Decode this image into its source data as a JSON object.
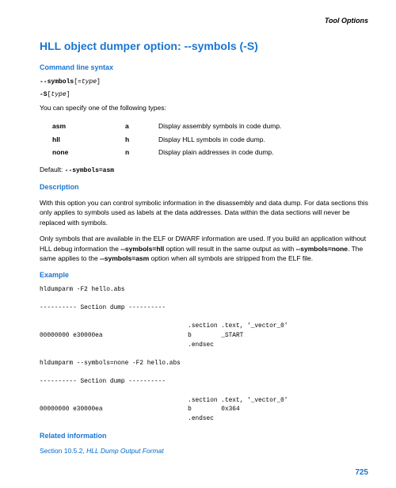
{
  "header": {
    "section": "Tool Options"
  },
  "title": "HLL object dumper option: --symbols (-S)",
  "sections": {
    "syntax": {
      "heading": "Command line syntax",
      "line1a": "--symbols",
      "line1b": "[=",
      "line1c": "type",
      "line1d": "]",
      "line2a": "-S",
      "line2b": "[",
      "line2c": "type",
      "line2d": "]",
      "intro": "You can specify one of the following types:",
      "table": [
        {
          "name": "asm",
          "short": "a",
          "desc": "Display assembly symbols in code dump."
        },
        {
          "name": "hll",
          "short": "h",
          "desc": "Display HLL symbols in code dump."
        },
        {
          "name": "none",
          "short": "n",
          "desc": "Display plain addresses in code dump."
        }
      ],
      "defaultLabel": "Default: ",
      "defaultValue": "--symbols=asm"
    },
    "description": {
      "heading": "Description",
      "para1": "With this option you can control symbolic information in the disassembly and data dump. For data sections this only applies to symbols used as labels at the data addresses. Data within the data sections will never be replaced with symbols.",
      "para2a": "Only symbols that are available in the ELF or DWARF information are used. If you build an application without HLL debug information the ",
      "para2b": "--symbols=hll",
      "para2c": " option will result in the same output as with ",
      "para2d": "--symbols=none",
      "para2e": ". The same applies to the ",
      "para2f": "--symbols=asm",
      "para2g": " option when all symbols are stripped from the ELF file."
    },
    "example": {
      "heading": "Example",
      "block1": "hldumparm -F2 hello.abs\n\n---------- Section dump ----------\n\n                                        .section .text, '_vector_0'\n00000000 e30000ea                       b        _START\n                                        .endsec\n\nhldumparm --symbols=none -F2 hello.abs\n\n---------- Section dump ----------\n\n                                        .section .text, '_vector_0'\n00000000 e30000ea                       b        0x364\n                                        .endsec"
    },
    "related": {
      "heading": "Related information",
      "linkA": "Section 10.5.2, ",
      "linkB": "HLL Dump Output Format"
    }
  },
  "pageNumber": "725"
}
